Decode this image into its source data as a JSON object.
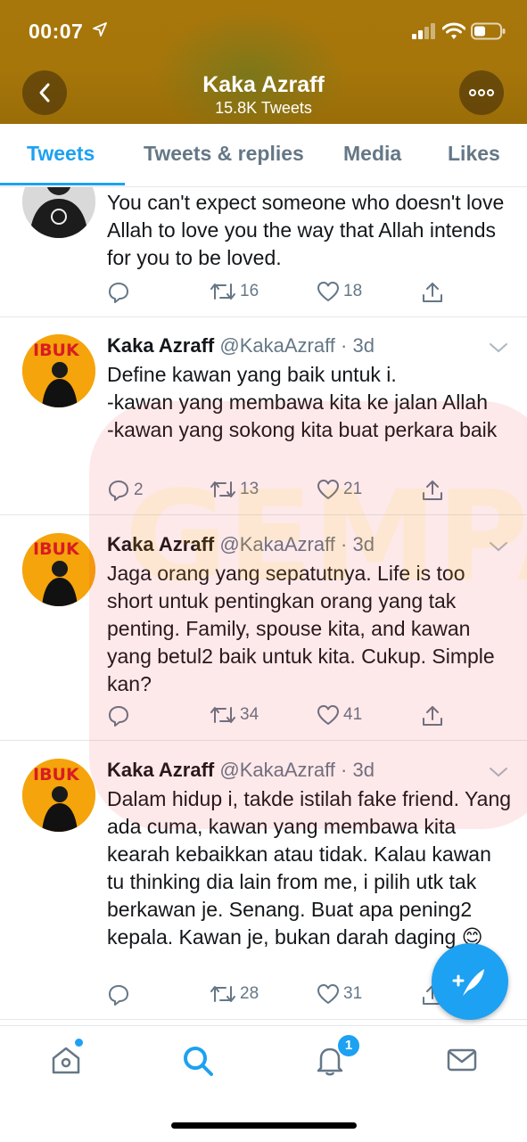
{
  "status_bar": {
    "time": "00:07"
  },
  "profile": {
    "name": "Kaka Azraff",
    "tweet_count": "15.8K Tweets"
  },
  "tabs": [
    {
      "label": "Tweets",
      "active": true
    },
    {
      "label": "Tweets & replies",
      "active": false
    },
    {
      "label": "Media",
      "active": false
    },
    {
      "label": "Likes",
      "active": false
    }
  ],
  "tweets": [
    {
      "text": "You can't expect someone who doesn't love Allah to love you the way that Allah intends for you to be loved.",
      "replies": "",
      "retweets": "16",
      "likes": "18"
    },
    {
      "name": "Kaka Azraff",
      "handle": "@KakaAzraff",
      "time": "· 3d",
      "text": "Define kawan yang baik untuk i.\n-kawan yang membawa kita ke jalan Allah\n-kawan yang sokong kita buat perkara baik",
      "replies": "2",
      "retweets": "13",
      "likes": "21"
    },
    {
      "name": "Kaka Azraff",
      "handle": "@KakaAzraff",
      "time": "· 3d",
      "text": "Jaga orang yang sepatutnya. Life is too short untuk pentingkan orang yang tak penting. Family, spouse kita, and kawan yang betul2 baik untuk kita. Cukup. Simple kan?",
      "replies": "",
      "retweets": "34",
      "likes": "41"
    },
    {
      "name": "Kaka Azraff",
      "handle": "@KakaAzraff",
      "time": "· 3d",
      "text": "Dalam hidup i, takde istilah fake friend. Yang ada cuma, kawan yang membawa kita kearah kebaikkan atau tidak. Kalau kawan tu thinking dia lain from me, i pilih utk tak berkawan je. Senang. Buat apa pening2 kepala. Kawan je, bukan darah daging 😊",
      "replies": "",
      "retweets": "28",
      "likes": "31"
    }
  ],
  "avatar_caption": "IBUK",
  "watermark_text": "GEMPAK",
  "nav": {
    "notification_count": "1"
  },
  "colors": {
    "accent": "#1da1f2",
    "header": "#a6760a",
    "muted": "#657786"
  }
}
